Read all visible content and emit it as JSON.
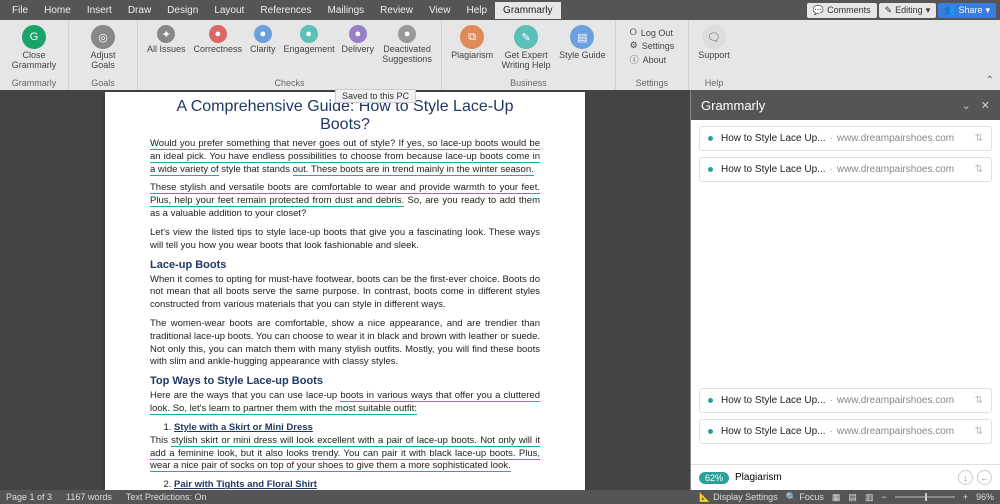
{
  "menu": {
    "items": [
      "File",
      "Home",
      "Insert",
      "Draw",
      "Design",
      "Layout",
      "References",
      "Mailings",
      "Review",
      "View",
      "Help",
      "Grammarly"
    ],
    "active": "Grammarly"
  },
  "topRight": {
    "comments": "Comments",
    "editing": "Editing",
    "share": "Share"
  },
  "ribbon": {
    "g1": {
      "close": "Close Grammarly",
      "label": "Grammarly"
    },
    "goals": {
      "adjust": "Adjust Goals",
      "label": "Goals"
    },
    "checks": {
      "all": "All Issues",
      "correct": "Correctness",
      "clarity": "Clarity",
      "engage": "Engagement",
      "delivery": "Delivery",
      "deact": "Deactivated Suggestions",
      "label": "Checks"
    },
    "biz": {
      "plag": "Plagiarism",
      "expert": "Get Expert Writing Help",
      "style": "Style Guide",
      "label": "Business"
    },
    "settings": {
      "logout": "Log Out",
      "settings": "Settings",
      "about": "About",
      "label": "Settings"
    },
    "help": {
      "support": "Support",
      "label": "Help"
    }
  },
  "toast": "Saved to this PC",
  "doc": {
    "title": "A Comprehensive Guide: How to Style Lace-Up Boots?",
    "p1a": "Would you prefer something that never goes out of style? If yes, so lace-up boots would be an ideal pick. You have endless possibilities to choose from because lace-up boots come in a wide variety of",
    "p1b": " style that stands ",
    "p1c": "out. These boots are in trend mainly in the winter season.",
    "p2a": "These stylish and versatile boots are comfortable to wear and provide warmth to your feet. Plus, help your feet remain protected from dust and debris.",
    "p2b": " So, are you ready to add them as a valuable addition to your closet?",
    "p3": "Let's view the listed tips to style lace-up boots that give you a fascinating look. These ways will tell you how you wear boots that look fashionable and sleek.",
    "h2a": "Lace-up Boots",
    "p4": "When it comes to opting for must-have footwear, boots can be the first-ever choice. Boots do not mean that all boots serve the same purpose. In contrast, boots come in different styles constructed from various materials that you can style in different ways.",
    "p5": "The women-wear boots are comfortable, show a nice appearance, and are trendier than traditional lace-up boots. You can choose to wear it in black and brown with leather or suede. Not only this, you can match them with many stylish outfits. Mostly, you will find these boots with slim and ankle-hugging appearance with classy styles.",
    "h2b": "Top Ways to Style Lace-up Boots",
    "p6a": "Here are the ways that you can use lace-up ",
    "p6b": "boots in various ways that offer you a cluttered look. So, let's learn to partner them with the most suitable outfit:",
    "li1": "Style with a Skirt or Mini Dress",
    "p7a": "This ",
    "p7b": "stylish skirt or mini dress will look excellent with a pair of lace-up boots. Not only will it add a feminine look, but it also looks trendy. You can pair it with black lace-up boots. Plus, wear a nice pair of socks on top of your shoes to give them a more sophisticated look.",
    "li2": "Pair with Tights and Floral Shirt"
  },
  "panel": {
    "title": "Grammarly",
    "cards": [
      {
        "title": "How to Style Lace Up...",
        "src": "www.dreampairshoes.com"
      },
      {
        "title": "How to Style Lace Up...",
        "src": "www.dreampairshoes.com"
      },
      {
        "title": "How to Style Lace Up...",
        "src": "www.dreampairshoes.com"
      },
      {
        "title": "How to Style Lace Up...",
        "src": "www.dreampairshoes.com"
      }
    ],
    "pct": "62%",
    "plag": "Plagiarism"
  },
  "status": {
    "page": "Page 1 of 3",
    "words": "1167 words",
    "pred": "Text Predictions: On",
    "display": "Display Settings",
    "focus": "Focus",
    "zoom": "96%"
  }
}
